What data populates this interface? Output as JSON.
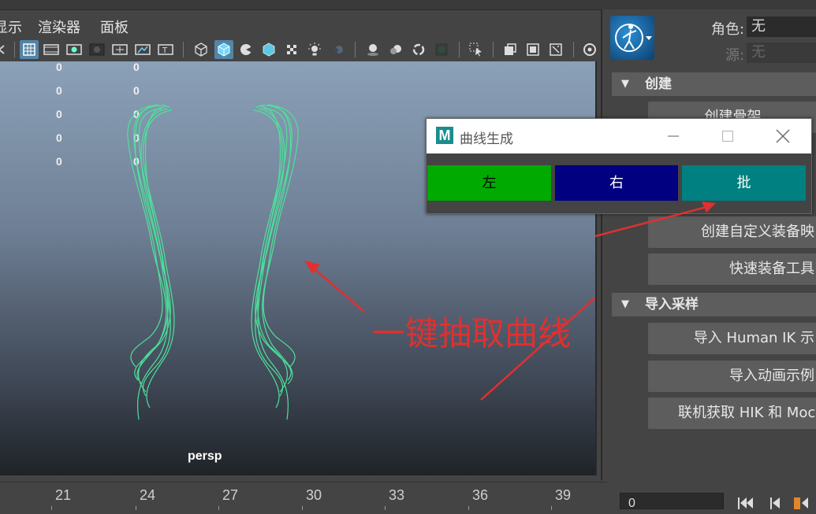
{
  "menu": {
    "items": [
      "显示",
      "渲染器",
      "面板"
    ]
  },
  "viewport": {
    "hud_col1": [
      "0",
      "0",
      "0",
      "0",
      "0"
    ],
    "hud_col2": [
      "0",
      "0",
      "0",
      "0",
      "0"
    ],
    "camera_label": "persp",
    "annotation_text": "一键抽取曲线",
    "curve_color": "#4be39a",
    "arrow_color": "#e03030"
  },
  "timeline": {
    "ticks": [
      "21",
      "24",
      "27",
      "30",
      "33",
      "36",
      "39"
    ],
    "current_frame": "0"
  },
  "right_panel": {
    "character_label": "角色:",
    "character_value": "无",
    "source_label": "源:",
    "source_value": "无",
    "section_create": "创建",
    "btn_create_skeleton": "创建骨架",
    "btn_custom_rig_map": "创建自定义装备映",
    "btn_quick_rig": "快速装备工具",
    "section_import": "导入采样",
    "btn_import_hik": "导入 Human IK 示",
    "btn_import_anim": "导入动画示例",
    "btn_online_hik": "联机获取 HIK 和 Moca"
  },
  "dialog": {
    "icon_letter": "M",
    "title": "曲线生成",
    "btn_left": "左",
    "btn_right": "右",
    "btn_batch": "批",
    "color_left": "#00aa00",
    "color_right": "#000080",
    "color_batch": "#008080"
  }
}
